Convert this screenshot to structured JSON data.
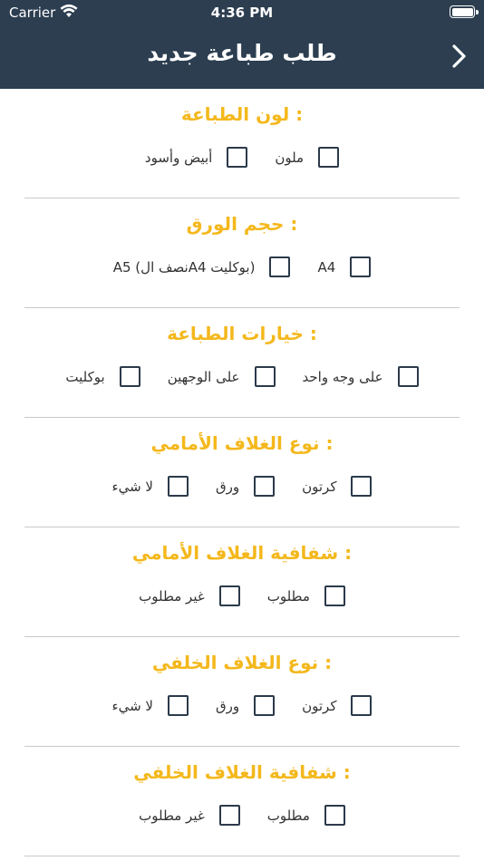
{
  "status_bar": {
    "carrier": "Carrier",
    "time": "4:36 PM"
  },
  "nav": {
    "title": "طلب طباعة جديد",
    "back_icon": "chevron-right-icon"
  },
  "sections": [
    {
      "title": "لون الطباعة :",
      "options": [
        {
          "label": "ملون",
          "checked": false
        },
        {
          "label": "أبيض وأسود",
          "checked": false
        }
      ]
    },
    {
      "title": "حجم الورق :",
      "options": [
        {
          "label": "A4",
          "checked": false
        },
        {
          "label": "A5 (نصف الA4 بوكليت)",
          "checked": false
        }
      ]
    },
    {
      "title": "خيارات الطباعة :",
      "options": [
        {
          "label": "على وجه واحد",
          "checked": false
        },
        {
          "label": "على الوجهين",
          "checked": false
        },
        {
          "label": "بوكليت",
          "checked": false
        }
      ]
    },
    {
      "title": "نوع الغلاف الأمامي :",
      "options": [
        {
          "label": "كرتون",
          "checked": false
        },
        {
          "label": "ورق",
          "checked": false
        },
        {
          "label": "لا شيء",
          "checked": false
        }
      ]
    },
    {
      "title": "شفافية الغلاف الأمامي :",
      "options": [
        {
          "label": "مطلوب",
          "checked": false
        },
        {
          "label": "غير مطلوب",
          "checked": false
        }
      ]
    },
    {
      "title": "نوع الغلاف الخلفي :",
      "options": [
        {
          "label": "كرتون",
          "checked": false
        },
        {
          "label": "ورق",
          "checked": false
        },
        {
          "label": "لا شيء",
          "checked": false
        }
      ]
    },
    {
      "title": "شفافية الغلاف الخلفي :",
      "options": [
        {
          "label": "مطلوب",
          "checked": false
        },
        {
          "label": "غير مطلوب",
          "checked": false
        }
      ]
    }
  ],
  "colors": {
    "nav_bg": "#2c3e50",
    "accent": "#f4b81c",
    "checkbox_border": "#2b3a4a"
  }
}
